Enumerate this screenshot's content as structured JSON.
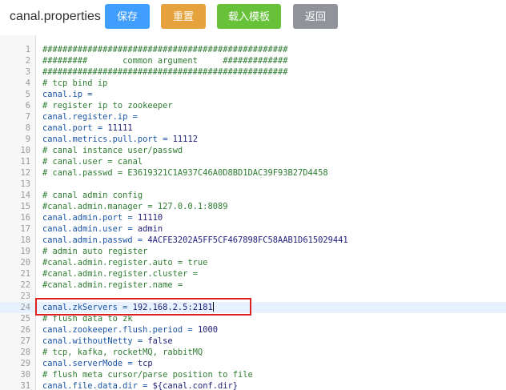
{
  "toolbar": {
    "file_title": "canal.properties",
    "save_label": "保存",
    "reset_label": "重置",
    "load_template_label": "载入模板",
    "back_label": "返回"
  },
  "editor": {
    "lines": [
      {
        "num": "1",
        "type": "comment",
        "text": "#################################################"
      },
      {
        "num": "2",
        "type": "comment",
        "text": "#########       common argument     #############"
      },
      {
        "num": "3",
        "type": "comment",
        "text": "#################################################"
      },
      {
        "num": "4",
        "type": "comment",
        "text": "# tcp bind ip"
      },
      {
        "num": "5",
        "type": "kv",
        "key": "canal.ip",
        "value": ""
      },
      {
        "num": "6",
        "type": "comment",
        "text": "# register ip to zookeeper"
      },
      {
        "num": "7",
        "type": "kv",
        "key": "canal.register.ip",
        "value": ""
      },
      {
        "num": "8",
        "type": "kv",
        "key": "canal.port",
        "value": "11111"
      },
      {
        "num": "9",
        "type": "kv",
        "key": "canal.metrics.pull.port",
        "value": "11112"
      },
      {
        "num": "10",
        "type": "comment",
        "text": "# canal instance user/passwd"
      },
      {
        "num": "11",
        "type": "comment",
        "text": "# canal.user = canal"
      },
      {
        "num": "12",
        "type": "comment",
        "text": "# canal.passwd = E3619321C1A937C46A0D8BD1DAC39F93B27D4458"
      },
      {
        "num": "13",
        "type": "blank",
        "text": ""
      },
      {
        "num": "14",
        "type": "comment",
        "text": "# canal admin config"
      },
      {
        "num": "15",
        "type": "comment",
        "text": "#canal.admin.manager = 127.0.0.1:8089"
      },
      {
        "num": "16",
        "type": "kv",
        "key": "canal.admin.port",
        "value": "11110"
      },
      {
        "num": "17",
        "type": "kv",
        "key": "canal.admin.user",
        "value": "admin"
      },
      {
        "num": "18",
        "type": "kv",
        "key": "canal.admin.passwd",
        "value": "4ACFE3202A5FF5CF467898FC58AAB1D615029441"
      },
      {
        "num": "19",
        "type": "comment",
        "text": "# admin auto register"
      },
      {
        "num": "20",
        "type": "comment",
        "text": "#canal.admin.register.auto = true"
      },
      {
        "num": "21",
        "type": "comment",
        "text": "#canal.admin.register.cluster ="
      },
      {
        "num": "22",
        "type": "comment",
        "text": "#canal.admin.register.name ="
      },
      {
        "num": "23",
        "type": "blank",
        "text": ""
      },
      {
        "num": "24",
        "type": "kv",
        "key": "canal.zkServers",
        "value": "192.168.2.5:2181",
        "active": true
      },
      {
        "num": "25",
        "type": "comment",
        "text": "# flush data to zk"
      },
      {
        "num": "26",
        "type": "kv",
        "key": "canal.zookeeper.flush.period",
        "value": "1000"
      },
      {
        "num": "27",
        "type": "kv",
        "key": "canal.withoutNetty",
        "value": "false"
      },
      {
        "num": "28",
        "type": "comment",
        "text": "# tcp, kafka, rocketMQ, rabbitMQ"
      },
      {
        "num": "29",
        "type": "kv",
        "key": "canal.serverMode",
        "value": "tcp"
      },
      {
        "num": "30",
        "type": "comment",
        "text": "# flush meta cursor/parse position to file"
      },
      {
        "num": "31",
        "type": "kv",
        "key": "canal.file.data.dir",
        "value": "${canal.conf.dir}"
      }
    ]
  },
  "colors": {
    "save": "#409eff",
    "reset": "#e6a23c",
    "load_template": "#67c23a",
    "back": "#909399",
    "highlight_border": "#e02020"
  }
}
